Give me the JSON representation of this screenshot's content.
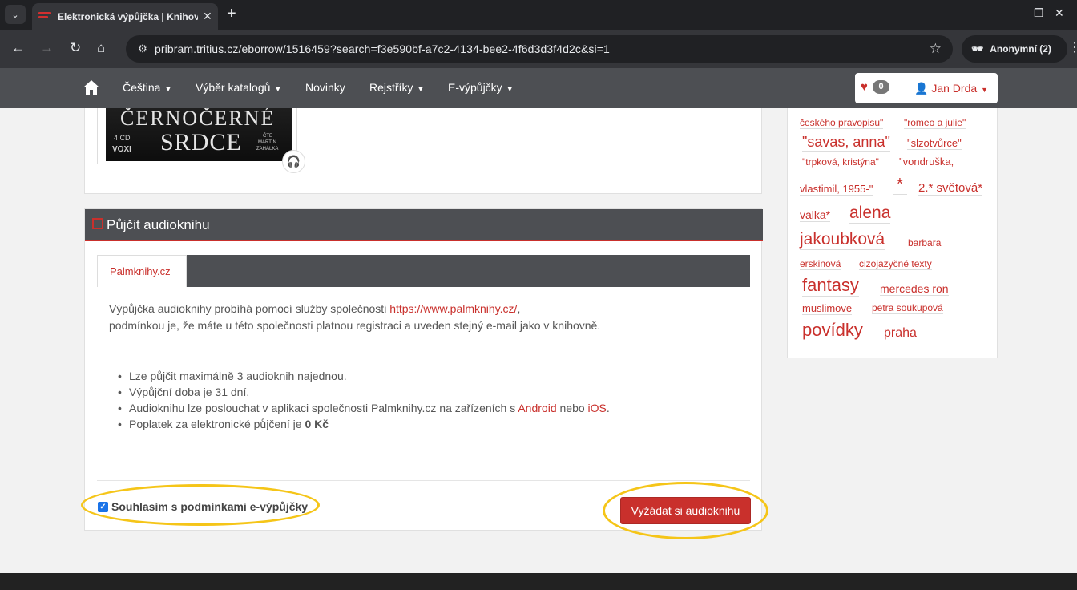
{
  "browser": {
    "tab_title": "Elektronická výpůjčka | Knihovna",
    "url": "pribram.tritius.cz/eborrow/1516459?search=f3e590bf-a7c2-4134-bee2-4f6d3d3f4d2c&si=1",
    "incognito_label": "Anonymní (2)"
  },
  "sitenav": {
    "items": [
      "Čeština",
      "Výběr katalogů",
      "Novinky",
      "Rejstříky",
      "E-výpůjčky"
    ],
    "favorites_count": "0",
    "user_name": "Jan Drda"
  },
  "cover": {
    "title_line1": "ČERNOČERNÉ",
    "title_line2": "SRDCE",
    "cd": "4 CD",
    "brand": "VOXI",
    "reader_line1": "ČTE",
    "reader_line2": "MARTIN",
    "reader_line3": "ZAHÁLKA"
  },
  "borrow": {
    "title": "Půjčit audioknihu",
    "tab_label": "Palmknihy.cz",
    "desc_prefix": "Výpůjčka audioknihy probíhá pomocí služby společnosti ",
    "desc_link": "https://www.palmknihy.cz/",
    "desc_suffix": ",",
    "desc_line2": "podmínkou je, že máte u této společnosti platnou registraci a uveden stejný e-mail jako v knihovně.",
    "bullet1": "Lze půjčit maximálně 3 audioknih najednou.",
    "bullet2": "Výpůjční doba je 31 dní.",
    "bullet3_prefix": "Audioknihu lze poslouchat v aplikaci společnosti Palmknihy.cz na zařízeních s ",
    "bullet3_android": "Android",
    "bullet3_mid": " nebo ",
    "bullet3_ios": "iOS",
    "bullet3_suffix": ".",
    "bullet4_prefix": "Poplatek za elektronické půjčení je ",
    "bullet4_fee": "0 Kč",
    "consent_label": "Souhlasím s podmínkami e-výpůjčky",
    "consent_checked": true,
    "submit_label": "Vyžádat si audioknihu"
  },
  "tags": [
    "českého pravopisu\"",
    "\"romeo a julie\"",
    "\"savas, anna\"",
    "\"slzotvůrce\"",
    "\"trpková, kristýna\"",
    "\"vondruška,",
    "vlastimil, 1955-\"",
    "*",
    "2.* světová*",
    "valka*",
    "alena",
    "jakoubková",
    "barbara",
    "erskinová",
    "cizojazyčné texty",
    "fantasy",
    "mercedes ron",
    "muslimove",
    "petra soukupová",
    "povídky",
    "praha"
  ],
  "colors": {
    "accent": "#c9302c",
    "nav": "#4d4f53",
    "highlight": "#f5c518"
  }
}
